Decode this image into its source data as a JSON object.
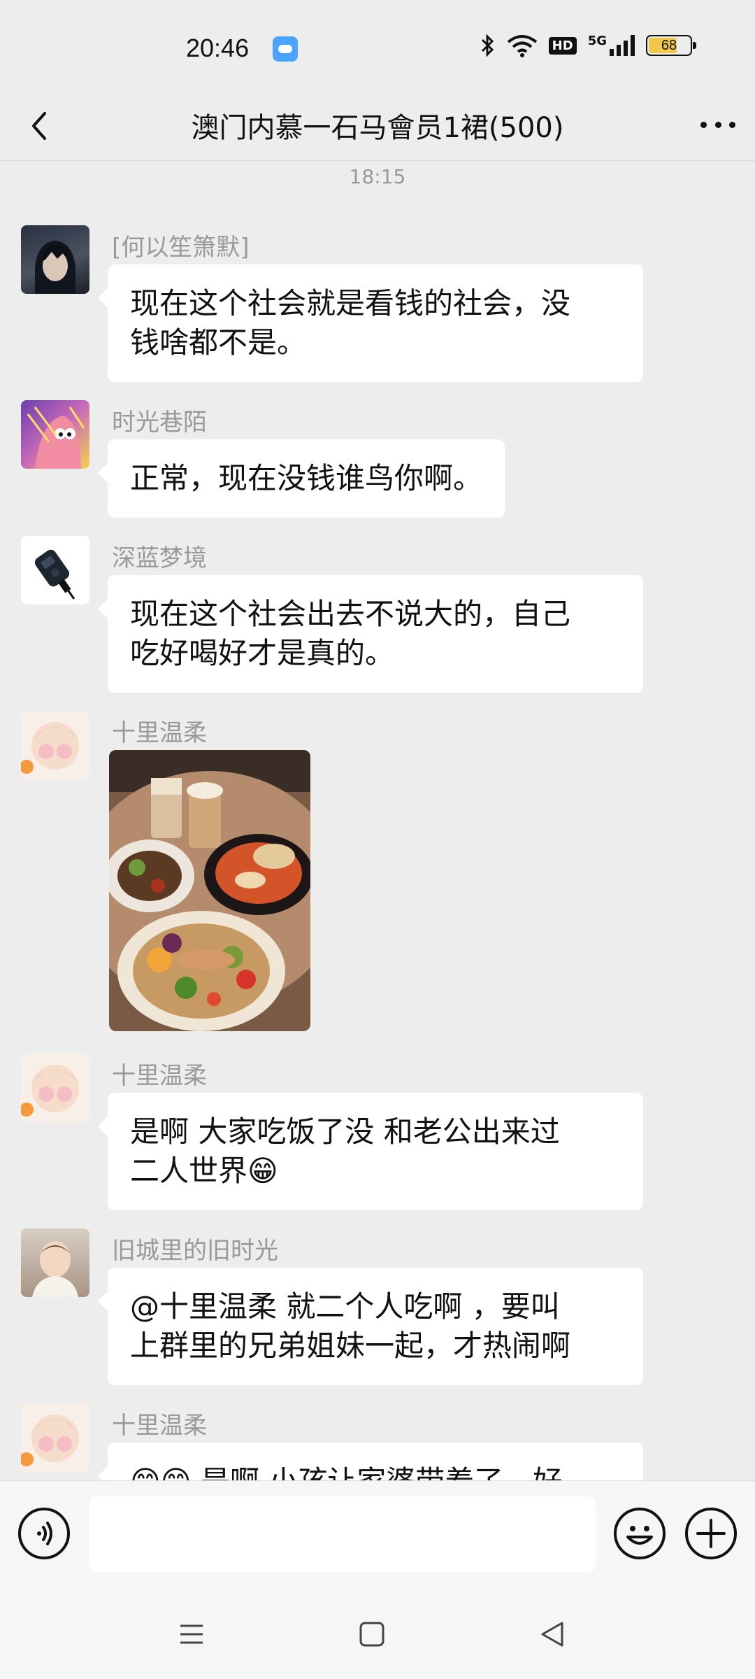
{
  "status_bar": {
    "time": "20:46",
    "network": "5G",
    "hd": "HD",
    "battery": "68"
  },
  "header": {
    "title": "澳门内慕一石马會员1裙(500)"
  },
  "timestamp": "18:15",
  "messages": [
    {
      "sender": "[何以笙箫默]",
      "text": "现在这个社会就是看钱的社会，没\n钱啥都不是。"
    },
    {
      "sender": "时光巷陌",
      "text": "正常，现在没钱谁鸟你啊。"
    },
    {
      "sender": "深蓝梦境",
      "text": "现在这个社会出去不说大的，自己\n吃好喝好才是真的。"
    },
    {
      "sender": "十里温柔",
      "type": "image"
    },
    {
      "sender": "十里温柔",
      "text": "是啊  大家吃饭了没 和老公出来过\n二人世界😁"
    },
    {
      "sender": "旧城里的旧时光",
      "text": "@十里温柔 就二个人吃啊 ，要叫\n上群里的兄弟姐妹一起，才热闹啊"
    },
    {
      "sender": "十里温柔",
      "text": "😊😊 是啊  小孩让家婆带着了，好"
    }
  ],
  "colors": {
    "background": "#ededed",
    "bubble": "#ffffff",
    "sender_text": "#999999",
    "battery_fill": "#f2c84b"
  }
}
